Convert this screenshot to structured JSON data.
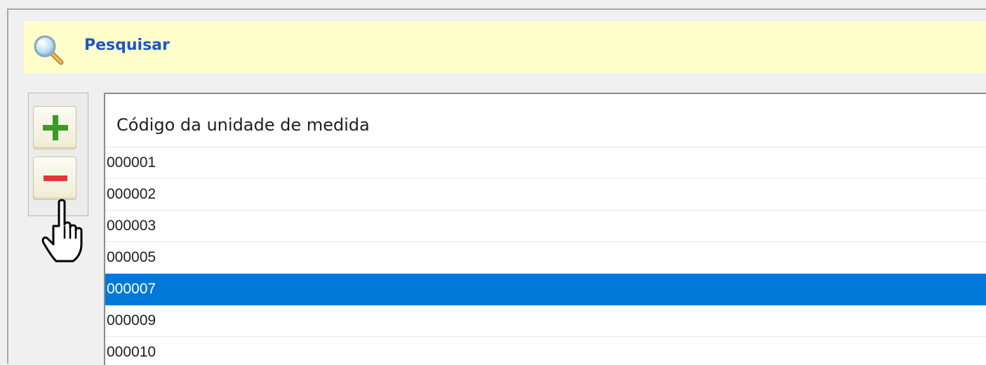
{
  "search": {
    "label": "Pesquisar",
    "icon": "magnifier-icon",
    "background_color": "#ffffcc",
    "label_color": "#1e56c8"
  },
  "toolbar": {
    "add_icon": "plus-icon",
    "remove_icon": "minus-icon",
    "add_color": "#3c9a2a",
    "remove_color": "#e8323c"
  },
  "grid": {
    "column_header": "Código da unidade de medida",
    "selected_color": "#0078d7",
    "rows": [
      {
        "code": "000001",
        "selected": false
      },
      {
        "code": "000002",
        "selected": false
      },
      {
        "code": "000003",
        "selected": false
      },
      {
        "code": "000005",
        "selected": false
      },
      {
        "code": "000007",
        "selected": true
      },
      {
        "code": "000009",
        "selected": false
      },
      {
        "code": "000010",
        "selected": false
      }
    ]
  },
  "cursor": {
    "icon": "hand-pointer-icon"
  }
}
